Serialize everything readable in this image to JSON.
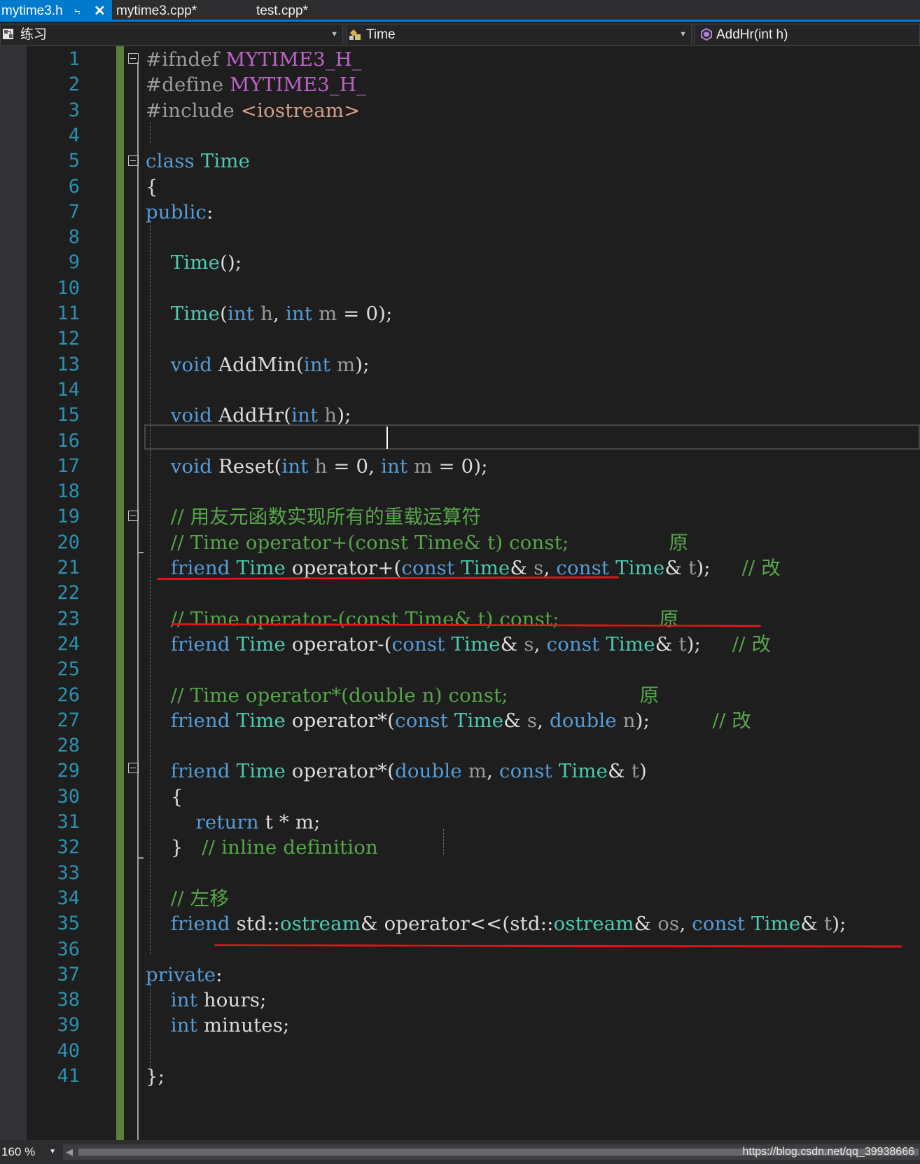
{
  "tabs": [
    {
      "label": "mytime3.h",
      "active": true,
      "pinned_icon": "pin-icon",
      "close_icon": "close-icon"
    },
    {
      "label": "mytime3.cpp*",
      "active": false
    },
    {
      "label": "test.cpp*",
      "active": false
    }
  ],
  "navbar": {
    "project": "练习",
    "class": "Time",
    "member": "AddHr(int h)"
  },
  "editor": {
    "line_numbers": [
      "1",
      "2",
      "3",
      "4",
      "5",
      "6",
      "7",
      "8",
      "9",
      "10",
      "11",
      "12",
      "13",
      "14",
      "15",
      "16",
      "17",
      "18",
      "19",
      "20",
      "21",
      "22",
      "23",
      "24",
      "25",
      "26",
      "27",
      "28",
      "29",
      "30",
      "31",
      "32",
      "33",
      "34",
      "35",
      "36",
      "37",
      "38",
      "39",
      "40",
      "41"
    ],
    "code_lines": [
      "#ifndef MYTIME3_H_",
      "#define MYTIME3_H_",
      "#include <iostream>",
      "",
      "class Time",
      "{",
      "public:",
      "",
      "    Time();",
      "",
      "    Time(int h, int m = 0);",
      "",
      "    void AddMin(int m);",
      "",
      "    void AddHr(int h);",
      "",
      "    void Reset(int h = 0, int m = 0);",
      "",
      "    // 用友元函数实现所有的重载运算符",
      "    // Time operator+(const Time& t) const;                原",
      "    friend Time operator+(const Time& s, const Time& t);     // 改",
      "",
      "    // Time operator-(const Time& t) const;                原",
      "    friend Time operator-(const Time& s, const Time& t);     // 改",
      "",
      "    // Time operator*(double n) const;                     原",
      "    friend Time operator*(const Time& s, double n);          // 改",
      "",
      "    friend Time operator*(double m, const Time& t)",
      "    {",
      "        return t * m;",
      "    }   // inline definition",
      "",
      "    // 左移",
      "    friend std::ostream& operator<<(std::ostream& os, const Time& t);",
      "",
      "private:",
      "    int hours;",
      "    int minutes;",
      "",
      "};"
    ],
    "current_line": 15
  },
  "statusbar": {
    "zoom": "160 %",
    "watermark": "https://blog.csdn.net/qq_39938666"
  },
  "colors": {
    "accent": "#007acc",
    "keyword": "#569cd6",
    "type": "#4ec9b0",
    "comment": "#57a64a",
    "macro": "#bd63c5",
    "include_path": "#d69d85",
    "line_number": "#2b91af",
    "change_bar": "#59803a",
    "annotation": "#e4141b"
  }
}
